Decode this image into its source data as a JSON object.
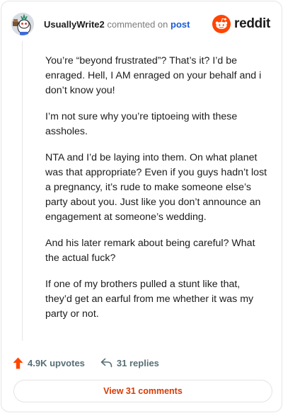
{
  "header": {
    "username": "UsuallyWrite2",
    "commented_on": "commented on",
    "post_link": "post",
    "brand": "reddit"
  },
  "comment": {
    "paragraphs": [
      "You’re “beyond frustrated”? That’s it? I’d be enraged. Hell, I AM enraged on your behalf and i don’t know you!",
      "I’m not sure why you’re tiptoeing with these assholes.",
      "NTA and I’d be laying into them. On what planet was that appropriate? Even if you guys hadn’t lost a pregnancy, it’s rude to make someone else’s party about you. Just like you don’t announce an engagement at someone’s wedding.",
      "And his later remark about being careful? What the actual fuck?",
      "If one of my brothers pulled a stunt like that, they’d get an earful from me whether it was my party or not."
    ]
  },
  "actions": {
    "upvotes": "4.9K upvotes",
    "replies": "31 replies",
    "view_comments": "View 31 comments"
  },
  "icons": {
    "avatar": "snoo-avatar-icon",
    "brand": "reddit-logo-icon",
    "upvote": "upvote-arrow-icon",
    "reply": "reply-arrow-icon"
  },
  "colors": {
    "accent": "#ff4500",
    "link": "#1a5bd6",
    "view_button_text": "#d93a00"
  }
}
